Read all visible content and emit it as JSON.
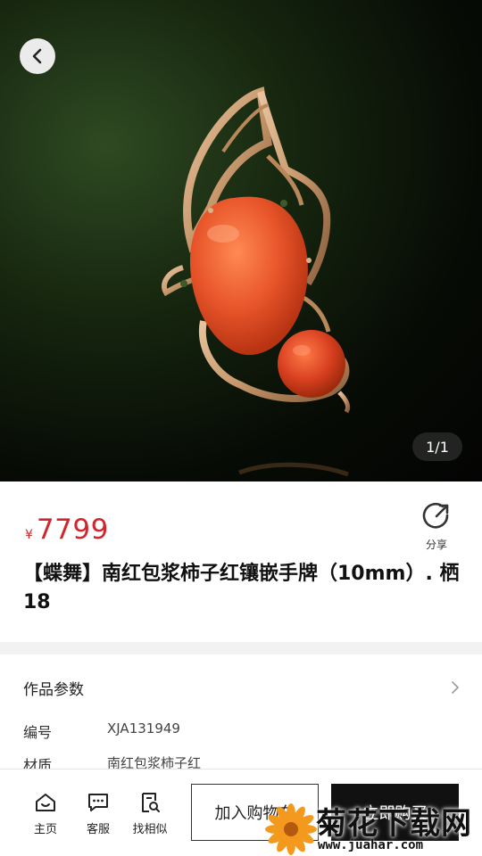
{
  "hero": {
    "image_alt": "butterfly pendant",
    "counter": "1/1"
  },
  "product": {
    "currency": "¥",
    "price": "7799",
    "share_label": "分享",
    "title": "【蝶舞】南红包浆柿子红镶嵌手牌（10mm）. 栖18"
  },
  "params": {
    "title": "作品参数",
    "rows": [
      {
        "key": "编号",
        "value": "XJA131949"
      },
      {
        "key": "材质",
        "value": "南红包浆柿子红"
      }
    ]
  },
  "bottom_nav": {
    "home": "主页",
    "service": "客服",
    "similar": "找相似",
    "add_to_cart": "加入购物车",
    "buy_now": "立即购买"
  },
  "watermark": {
    "text": "菊花下载网",
    "url": "www.juahar.com"
  },
  "colors": {
    "price_red": "#d0262c",
    "stone_orange": "#e8552a",
    "gold": "#c99a6e",
    "button_black": "#111111"
  }
}
